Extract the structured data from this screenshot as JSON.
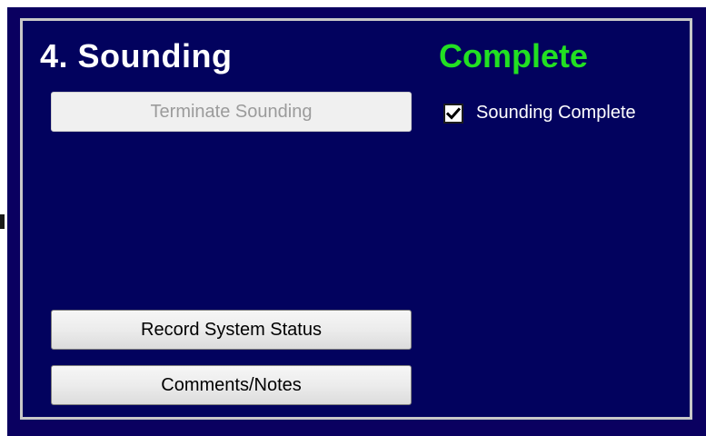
{
  "section": {
    "title": "4. Sounding",
    "status": "Complete"
  },
  "buttons": {
    "terminate_label": "Terminate Sounding",
    "terminate_enabled": false,
    "record_label": "Record System Status",
    "comments_label": "Comments/Notes"
  },
  "checkbox": {
    "label": "Sounding Complete",
    "checked": true,
    "icon": "checkmark-icon"
  },
  "colors": {
    "panel_background": "#02025e",
    "panel_border": "#c8c8c8",
    "status_complete": "#22e022",
    "title_text": "#ffffff"
  }
}
